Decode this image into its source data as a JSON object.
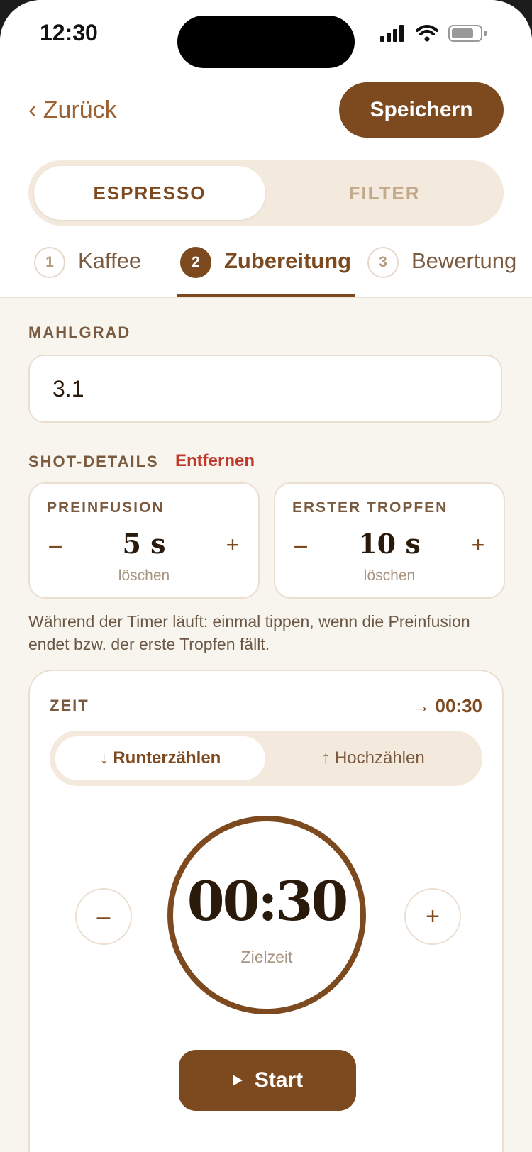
{
  "status": {
    "time": "12:30"
  },
  "header": {
    "back_label": "‹ Zurück",
    "save_label": "Speichern"
  },
  "brew_type": {
    "options": [
      "ESPRESSO",
      "FILTER"
    ],
    "selected": "ESPRESSO"
  },
  "steps": [
    {
      "number": "1",
      "label": "Kaffee"
    },
    {
      "number": "2",
      "label": "Zubereitung"
    },
    {
      "number": "3",
      "label": "Bewertung"
    }
  ],
  "grind": {
    "label": "MAHLGRAD",
    "value": "3.1"
  },
  "shot": {
    "label": "SHOT-DETAILS",
    "remove_label": "Entfernen",
    "cards": [
      {
        "title": "PREINFUSION",
        "value": "5 s",
        "clear_label": "löschen",
        "minus": "–",
        "plus": "+"
      },
      {
        "title": "ERSTER TROPFEN",
        "value": "10 s",
        "clear_label": "löschen",
        "minus": "–",
        "plus": "+"
      }
    ],
    "hint": "Während der Timer läuft: einmal tippen, wenn die Preinfusion endet bzw. der erste Tropfen fällt."
  },
  "timer": {
    "label": "ZEIT",
    "target": "→ 00:30",
    "modes": [
      "↓ Runterzählen",
      "↑ Hochzählen"
    ],
    "selected_mode": "↓ Runterzählen",
    "time": "00:30",
    "sub": "Zielzeit",
    "minus": "–",
    "plus": "+",
    "start_label": "Start"
  },
  "colors": {
    "accent": "#7d4a20",
    "background": "#f8f4ee",
    "remove": "#c0392b"
  }
}
